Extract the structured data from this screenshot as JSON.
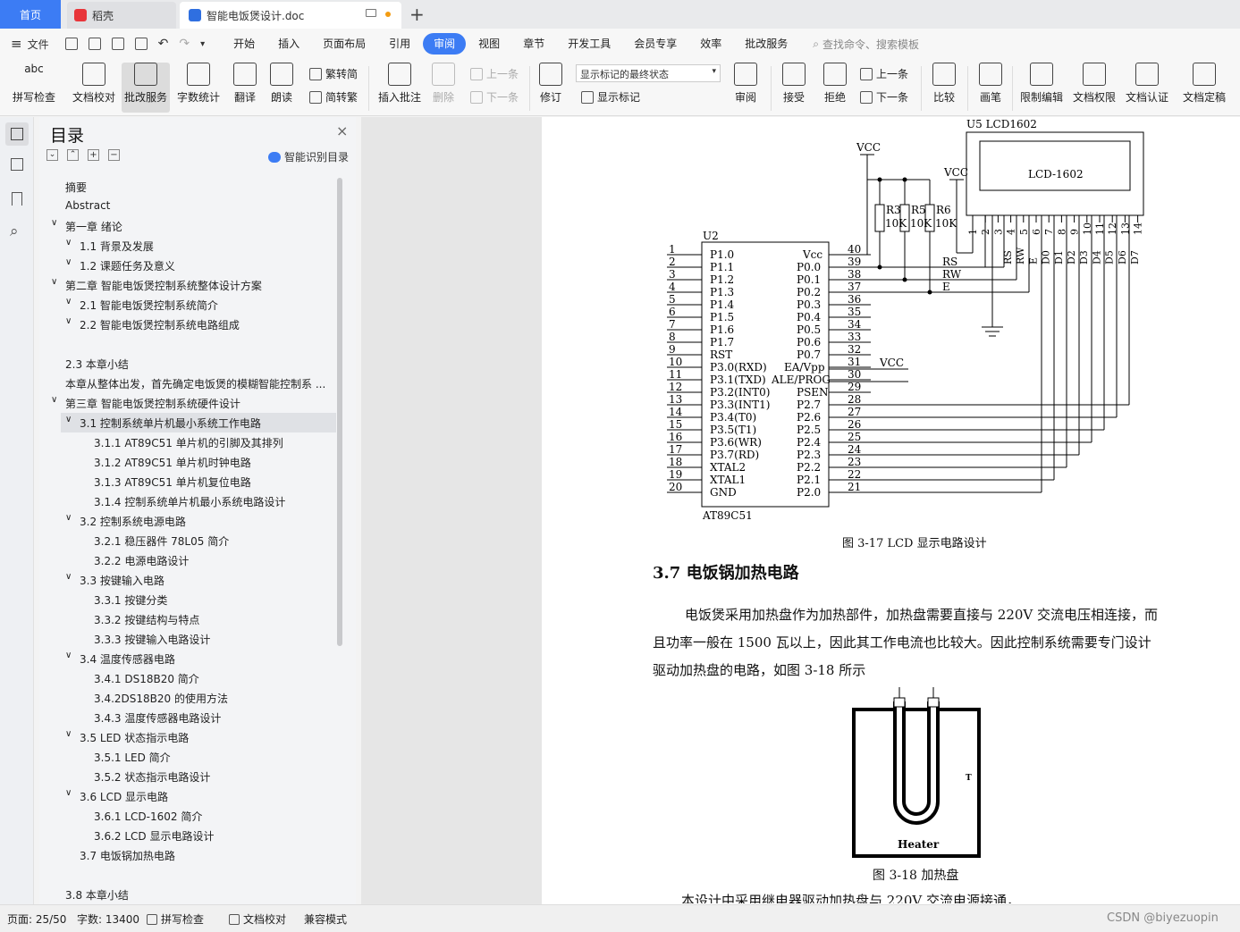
{
  "titlebar": {
    "home_tab": "首页",
    "daoke_tab": "稻壳",
    "doc_tab": "智能电饭煲设计.doc",
    "new_tab": "+"
  },
  "menubar": {
    "file": "文件",
    "items": [
      "开始",
      "插入",
      "页面布局",
      "引用",
      "审阅",
      "视图",
      "章节",
      "开发工具",
      "会员专享",
      "效率",
      "批改服务"
    ],
    "active": "审阅",
    "search_placeholder": "查找命令、搜索模板"
  },
  "ribbon": {
    "spellcheck": "拼写检查",
    "doccheck": "文档校对",
    "revise_service": "批改服务",
    "wordcount": "字数统计",
    "translate": "翻译",
    "read_aloud": "朗读",
    "to_traditional": "繁转简",
    "to_simplified": "简转繁",
    "insert_comment": "插入批注",
    "delete": "删除",
    "prev_comment": "上一条",
    "next_comment": "下一条",
    "track_changes": "修订",
    "display_state": "显示标记的最终状态",
    "show_markup": "显示标记",
    "review": "审阅",
    "accept": "接受",
    "reject": "拒绝",
    "prev_change": "上一条",
    "next_change": "下一条",
    "compare": "比较",
    "pen": "画笔",
    "restrict_edit": "限制编辑",
    "doc_permission": "文档权限",
    "doc_certify": "文档认证",
    "doc_finalize": "文档定稿"
  },
  "toc": {
    "title": "目录",
    "smart_toc": "智能识别目录",
    "items": [
      {
        "text": "摘要",
        "level": 0
      },
      {
        "text": "Abstract",
        "level": 0
      },
      {
        "text": "第一章  绪论",
        "level": 1
      },
      {
        "text": "1.1  背景及发展",
        "level": 2
      },
      {
        "text": "1.2  课题任务及意义",
        "level": 2
      },
      {
        "text": "第二章  智能电饭煲控制系统整体设计方案",
        "level": 1
      },
      {
        "text": "2.1  智能电饭煲控制系统简介",
        "level": 2
      },
      {
        "text": "2.2  智能电饭煲控制系统电路组成",
        "level": 2
      },
      {
        "text": "",
        "level": 0
      },
      {
        "text": "2.3  本章小结",
        "level": 0
      },
      {
        "text": "本章从整体出发，首先确定电饭煲的模糊智能控制系 ...",
        "level": 0
      },
      {
        "text": "第三章  智能电饭煲控制系统硬件设计",
        "level": 1
      },
      {
        "text": "3.1  控制系统单片机最小系统工作电路",
        "level": 2
      },
      {
        "text": "3.1.1 AT89C51 单片机的引脚及其排列",
        "level": 3
      },
      {
        "text": "3.1.2 AT89C51 单片机时钟电路",
        "level": 3
      },
      {
        "text": "3.1.3 AT89C51 单片机复位电路",
        "level": 3
      },
      {
        "text": "3.1.4 控制系统单片机最小系统电路设计",
        "level": 3
      },
      {
        "text": "3.2  控制系统电源电路",
        "level": 2
      },
      {
        "text": "3.2.1 稳压器件 78L05 简介",
        "level": 3
      },
      {
        "text": "3.2.2 电源电路设计",
        "level": 3
      },
      {
        "text": "3.3  按键输入电路",
        "level": 2
      },
      {
        "text": "3.3.1 按键分类",
        "level": 3
      },
      {
        "text": "3.3.2 按键结构与特点",
        "level": 3
      },
      {
        "text": "3.3.3  按键输入电路设计",
        "level": 3
      },
      {
        "text": "3.4  温度传感器电路",
        "level": 2
      },
      {
        "text": "3.4.1 DS18B20 简介",
        "level": 3
      },
      {
        "text": "3.4.2DS18B20 的使用方法",
        "level": 3
      },
      {
        "text": "3.4.3 温度传感器电路设计",
        "level": 3
      },
      {
        "text": "3.5 LED 状态指示电路",
        "level": 2
      },
      {
        "text": "3.5.1 LED 简介",
        "level": 3
      },
      {
        "text": "3.5.2  状态指示电路设计",
        "level": 3
      },
      {
        "text": "3.6 LCD 显示电路",
        "level": 2
      },
      {
        "text": "3.6.1 LCD-1602 简介",
        "level": 3
      },
      {
        "text": "3.6.2 LCD 显示电路设计",
        "level": 3
      },
      {
        "text": "3.7 电饭锅加热电路",
        "level": 4
      },
      {
        "text": "",
        "level": 0
      },
      {
        "text": "3.8  本章小结",
        "level": 0
      }
    ]
  },
  "doc": {
    "circuit": {
      "vcc": "VCC",
      "u5": "U5   LCD1602",
      "lcd_label": "LCD-1602",
      "u2": "U2",
      "chip": "AT89C51",
      "r3": "R3",
      "r5": "R5",
      "r6": "R6",
      "rval": "10K",
      "left_pins": [
        "P1.0",
        "P1.1",
        "P1.2",
        "P1.3",
        "P1.4",
        "P1.5",
        "P1.6",
        "P1.7",
        "RST",
        "P3.0(RXD)",
        "P3.1(TXD)",
        "P3.2(INT0)",
        "P3.3(INT1)",
        "P3.4(T0)",
        "P3.5(T1)",
        "P3.6(WR)",
        "P3.7(RD)",
        "XTAL2",
        "XTAL1",
        "GND"
      ],
      "right_pins": [
        "Vcc",
        "P0.0",
        "P0.1",
        "P0.2",
        "P0.3",
        "P0.4",
        "P0.5",
        "P0.6",
        "P0.7",
        "EA/Vpp",
        "ALE/PROG",
        "PSEN",
        "P2.7",
        "P2.6",
        "P2.5",
        "P2.4",
        "P2.3",
        "P2.2",
        "P2.1",
        "P2.0"
      ],
      "right_nums": [
        "40",
        "39",
        "38",
        "37",
        "36",
        "35",
        "34",
        "33",
        "32",
        "31",
        "30",
        "29",
        "28",
        "27",
        "26",
        "25",
        "24",
        "23",
        "22",
        "21"
      ],
      "signals": [
        "RS",
        "RW",
        "E"
      ],
      "lcd_pins": [
        "1",
        "2",
        "3",
        "4",
        "5",
        "6",
        "7",
        "8",
        "9",
        "10",
        "11",
        "12",
        "13",
        "14"
      ],
      "lcd_sigs": [
        "RS",
        "RW",
        "E",
        "D0",
        "D1",
        "D2",
        "D3",
        "D4",
        "D5",
        "D6",
        "D7"
      ]
    },
    "fig17_caption": "图 3-17 LCD 显示电路设计",
    "section_heading": "3.7 电饭锅加热电路",
    "para1": "电饭煲采用加热盘作为加热部件，加热盘需要直接与 220V 交流电压相连接，而",
    "para2": "且功率一般在 1500 瓦以上，因此其工作电流也比较大。因此控制系统需要专门设计",
    "para3": "驱动加热盘的电路，如图 3-18 所示",
    "heater_label": "Heater",
    "heater_t": "T",
    "fig18_caption": "图 3-18  加热盘",
    "para4": "本设计中采用继电器驱动加热盘与 220V 交流电源接通，"
  },
  "status": {
    "page": "页面: 25/50",
    "words": "字数: 13400",
    "spellcheck": "拼写检查",
    "doccheck": "文档校对",
    "compat": "兼容模式",
    "watermark": "CSDN @biyezuopin"
  },
  "colors": {
    "accent": "#3c7cf4",
    "wps_red": "#e8353a"
  }
}
